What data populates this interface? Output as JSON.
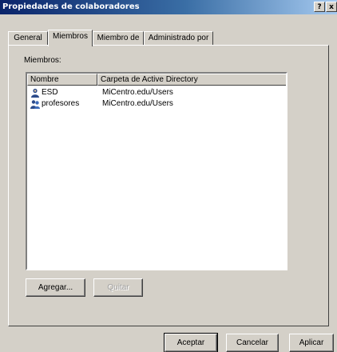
{
  "window": {
    "title": "Propiedades de colaboradores",
    "help_glyph": "?",
    "close_glyph": "x"
  },
  "tabs": [
    {
      "label": "General"
    },
    {
      "label": "Miembros"
    },
    {
      "label": "Miembro de"
    },
    {
      "label": "Administrado por"
    }
  ],
  "members_label": "Miembros:",
  "list": {
    "columns": [
      "Nombre",
      "Carpeta de Active Directory"
    ],
    "rows": [
      {
        "name": "ESD",
        "path": "MiCentro.edu/Users",
        "icon": "user-icon"
      },
      {
        "name": "profesores",
        "path": "MiCentro.edu/Users",
        "icon": "group-icon"
      }
    ]
  },
  "buttons": {
    "add": "Agregar...",
    "remove": "Quitar",
    "ok": "Aceptar",
    "cancel": "Cancelar",
    "apply": "Aplicar"
  }
}
